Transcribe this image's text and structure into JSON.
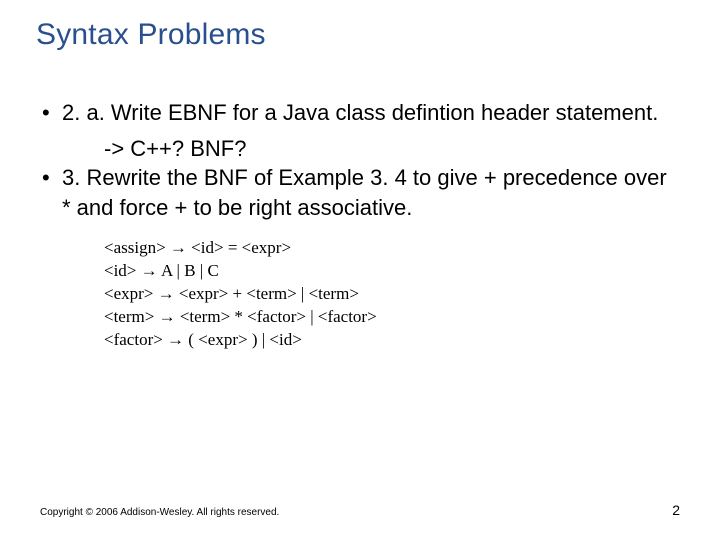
{
  "title": "Syntax Problems",
  "bullets": {
    "b1": "2. a. Write EBNF for a Java class defintion header statement.",
    "b1_sub": "-> C++?  BNF?",
    "b2": "3. Rewrite the BNF of Example 3. 4 to give + precedence over * and force + to be right associative."
  },
  "grammar": {
    "l1": "<assign> → <id> = <expr>",
    "l2": "<id> → A | B | C",
    "l3": "<expr> → <expr> + <term> | <term>",
    "l4": "<term> → <term> * <factor> | <factor>",
    "l5": "<factor> → ( <expr> ) | <id>"
  },
  "footer": {
    "copyright": "Copyright © 2006 Addison-Wesley. All rights reserved.",
    "page": "2"
  }
}
